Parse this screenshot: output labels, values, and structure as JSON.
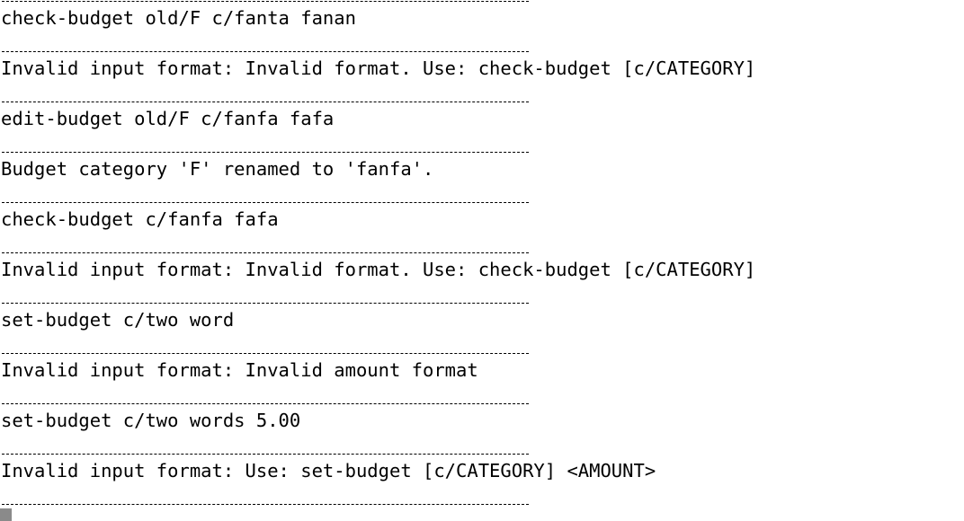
{
  "terminal": {
    "lines": [
      "check-budget old/F c/fanta fanan",
      "Invalid input format: Invalid format. Use: check-budget [c/CATEGORY]",
      "edit-budget old/F c/fanfa fafa",
      "Budget category 'F' renamed to 'fanfa'.",
      "check-budget c/fanfa fafa",
      "Invalid input format: Invalid format. Use: check-budget [c/CATEGORY]",
      "set-budget c/two word",
      "Invalid input format: Invalid amount format",
      "set-budget c/two words 5.00",
      "Invalid input format: Use: set-budget [c/CATEGORY] <AMOUNT>"
    ]
  }
}
